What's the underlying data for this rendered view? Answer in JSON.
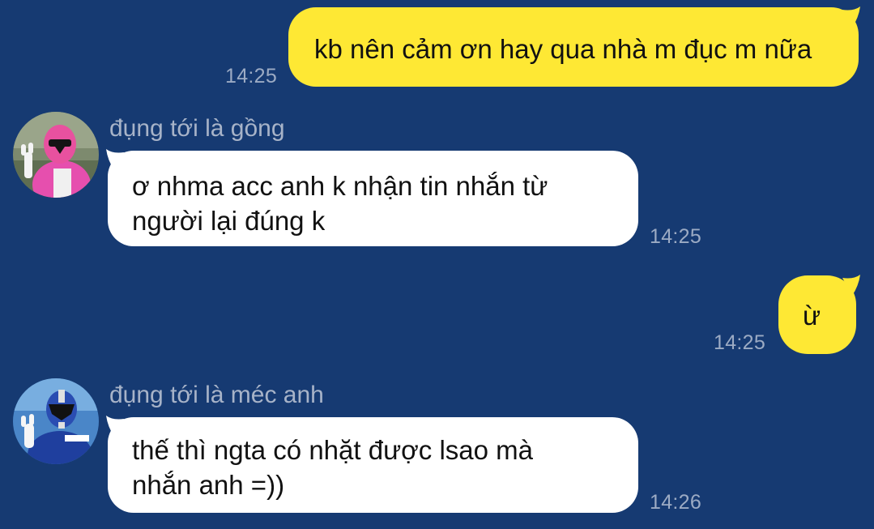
{
  "colors": {
    "background": "#163a72",
    "outgoing_bubble": "#fee834",
    "incoming_bubble": "#ffffff",
    "timestamp": "#9cabc4",
    "sender_name": "#a7b3c8"
  },
  "messages": [
    {
      "direction": "outgoing",
      "text": "kb nên cảm ơn hay qua nhà m đục m nữa",
      "time": "14:25"
    },
    {
      "direction": "incoming",
      "sender": "đụng tới là gồng",
      "avatar_icon": "pink-ranger-avatar",
      "lines": [
        "ơ nhma acc anh k nhận tin nhắn từ",
        "người lại đúng k"
      ],
      "time": "14:25"
    },
    {
      "direction": "outgoing",
      "text": "ừ",
      "time": "14:25"
    },
    {
      "direction": "incoming",
      "sender": "đụng tới là méc anh",
      "avatar_icon": "blue-ranger-avatar",
      "lines": [
        "thế thì ngta có nhặt được lsao mà",
        "nhắn anh =))"
      ],
      "time": "14:26"
    }
  ]
}
